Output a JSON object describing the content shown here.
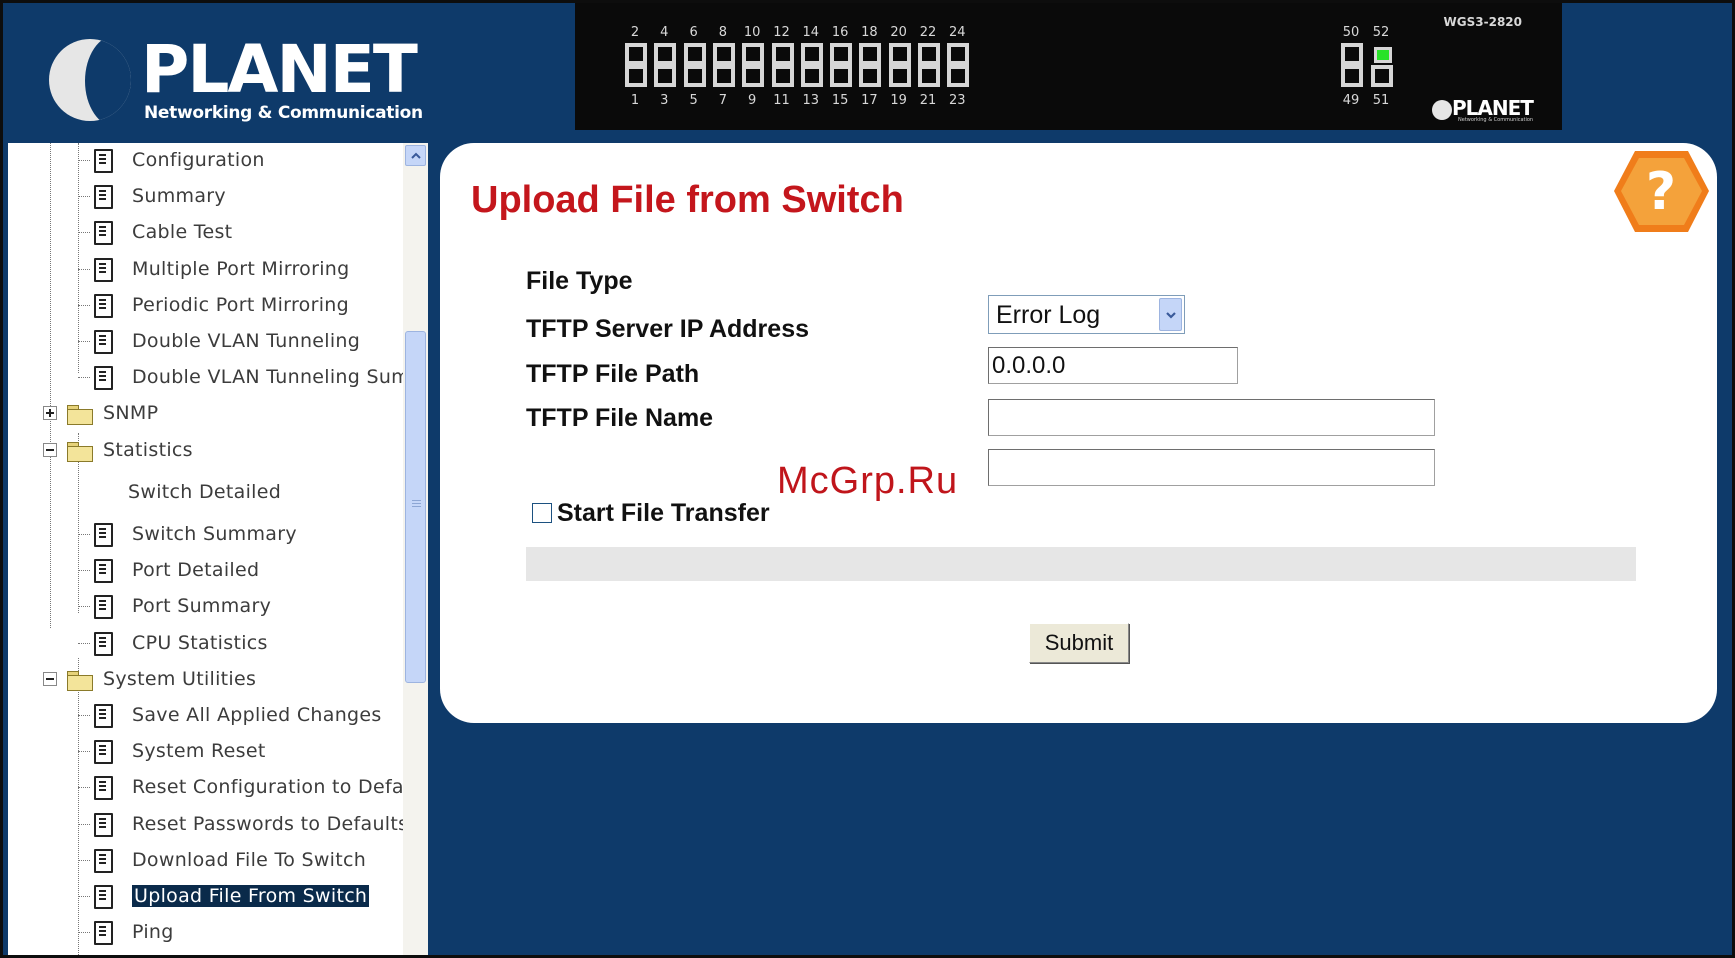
{
  "header": {
    "brand": "PLANET",
    "tagline": "Networking & Communication",
    "device": {
      "model": "WGS3-2820",
      "top_ports": [
        "2",
        "4",
        "6",
        "8",
        "10",
        "12",
        "14",
        "16",
        "18",
        "20",
        "22",
        "24"
      ],
      "bottom_ports": [
        "1",
        "3",
        "5",
        "7",
        "9",
        "11",
        "13",
        "15",
        "17",
        "19",
        "21",
        "23"
      ],
      "uplink_top": [
        "50",
        "52"
      ],
      "uplink_bottom": [
        "49",
        "51"
      ],
      "lit_port": "52",
      "lit_color": "#29e229",
      "brand": "PLANET",
      "brand_tagline": "Networking & Communication"
    }
  },
  "sidebar": {
    "items": [
      {
        "label": "Configuration",
        "type": "doc"
      },
      {
        "label": "Summary",
        "type": "doc"
      },
      {
        "label": "Cable Test",
        "type": "doc"
      },
      {
        "label": "Multiple Port Mirroring",
        "type": "doc"
      },
      {
        "label": "Periodic Port Mirroring",
        "type": "doc"
      },
      {
        "label": "Double VLAN Tunneling",
        "type": "doc"
      },
      {
        "label": "Double VLAN Tunneling Summ",
        "type": "doc"
      },
      {
        "label": "SNMP",
        "type": "folder",
        "state": "collapsed"
      },
      {
        "label": "Statistics",
        "type": "folder",
        "state": "expanded"
      },
      {
        "label": "Switch Detailed",
        "type": "text"
      },
      {
        "label": "Switch Summary",
        "type": "doc"
      },
      {
        "label": "Port Detailed",
        "type": "doc"
      },
      {
        "label": "Port Summary",
        "type": "doc"
      },
      {
        "label": "CPU Statistics",
        "type": "doc"
      },
      {
        "label": "System Utilities",
        "type": "folder",
        "state": "expanded"
      },
      {
        "label": "Save All Applied Changes",
        "type": "doc"
      },
      {
        "label": "System Reset",
        "type": "doc"
      },
      {
        "label": "Reset Configuration to Defau",
        "type": "doc"
      },
      {
        "label": "Reset Passwords to Defaults",
        "type": "doc"
      },
      {
        "label": "Download File To Switch",
        "type": "doc"
      },
      {
        "label": "Upload File From Switch",
        "type": "doc",
        "selected": true
      },
      {
        "label": "Ping",
        "type": "doc"
      }
    ]
  },
  "main": {
    "title": "Upload File from Switch",
    "title_color": "#c4161c",
    "help_icon": "question-icon",
    "help_color": "#f07d1a",
    "form": {
      "file_type_label": "File Type",
      "file_type_value": "Error Log",
      "tftp_ip_label": "TFTP Server IP Address",
      "tftp_ip_value": "0.0.0.0",
      "tftp_path_label": "TFTP File Path",
      "tftp_path_value": "",
      "tftp_name_label": "TFTP File Name",
      "tftp_name_value": "",
      "start_transfer_label": "Start File Transfer",
      "start_transfer_checked": false,
      "submit_label": "Submit"
    }
  },
  "watermark": "McGrp.Ru",
  "colors": {
    "background": "#0e3a6a",
    "selected_bg": "#0a2a4a",
    "accent": "#c4161c"
  }
}
